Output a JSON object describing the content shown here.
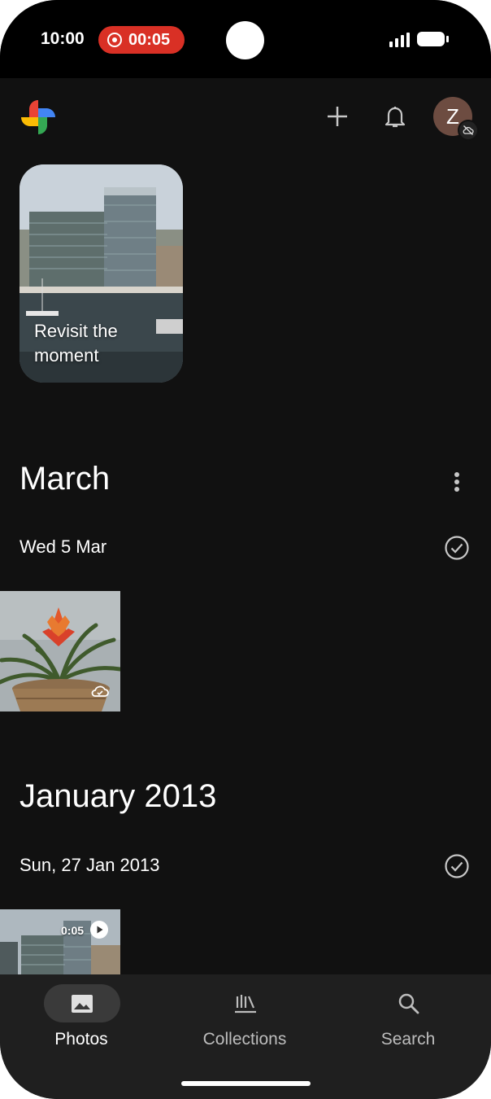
{
  "status_bar": {
    "time": "10:00",
    "recording_time": "00:05",
    "recording_color": "#d93025"
  },
  "app_bar": {
    "logo": "google-photos-pinwheel",
    "add_icon": "plus-icon",
    "notifications_icon": "bell-icon",
    "avatar_letter": "Z",
    "avatar_badge_icon": "cloud-off-icon",
    "avatar_color": "#6d4c41"
  },
  "memory_card": {
    "label": "Revisit the moment"
  },
  "sections": [
    {
      "month": "March",
      "date": "Wed 5 Mar",
      "photo": {
        "subject": "potted bromeliad plant",
        "status_icon": "cloud-icon"
      }
    },
    {
      "month": "January 2013",
      "date": "Sun, 27 Jan 2013",
      "video": {
        "subject": "harbour office buildings",
        "duration": "0:05",
        "play_icon": "play-icon"
      }
    }
  ],
  "bottom_nav": {
    "items": [
      {
        "label": "Photos",
        "icon": "photo-icon",
        "active": true
      },
      {
        "label": "Collections",
        "icon": "library-icon",
        "active": false
      },
      {
        "label": "Search",
        "icon": "search-icon",
        "active": false
      }
    ]
  }
}
